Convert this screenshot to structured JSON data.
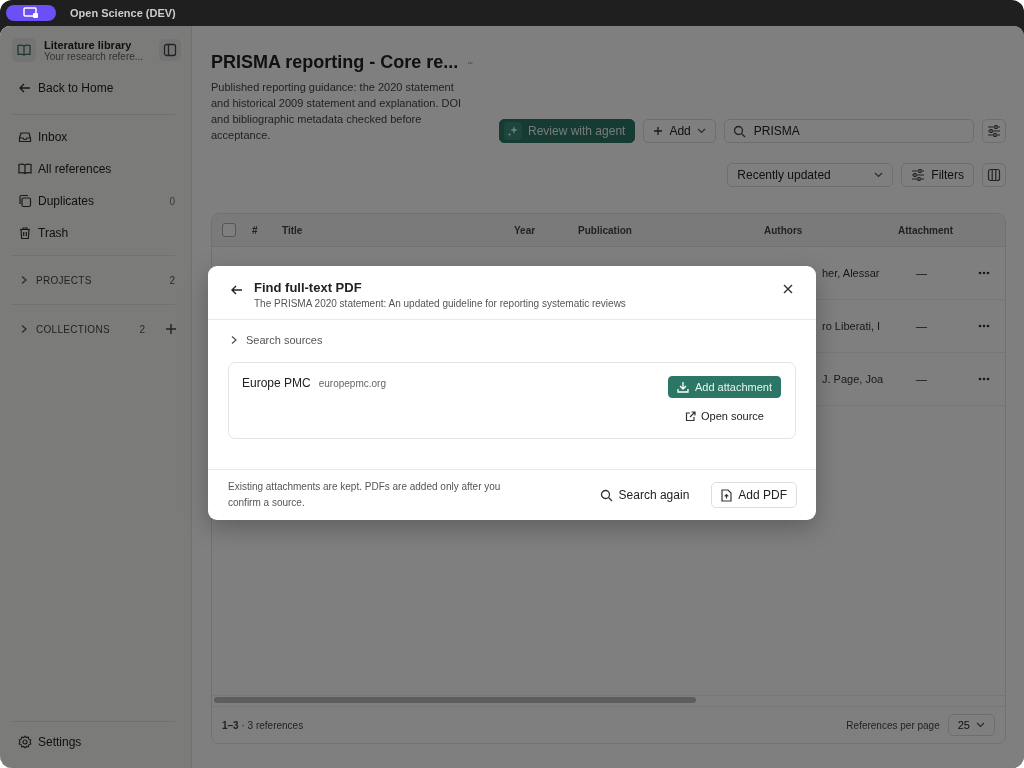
{
  "app_bar": {
    "title": "Open Science (DEV)"
  },
  "sidebar": {
    "library": {
      "title": "Literature library",
      "subtitle": "Your research refere..."
    },
    "back": "Back to Home",
    "items": [
      {
        "kind": "inbox",
        "label": "Inbox"
      },
      {
        "kind": "references",
        "label": "All references"
      },
      {
        "kind": "duplicates",
        "label": "Duplicates",
        "count": "0"
      },
      {
        "kind": "trash",
        "label": "Trash"
      }
    ],
    "sections": [
      {
        "label": "PROJECTS",
        "count": "2",
        "expanded": false,
        "addable": false
      },
      {
        "label": "COLLECTIONS",
        "count": "2",
        "expanded": false,
        "addable": true
      }
    ],
    "settings": "Settings"
  },
  "header": {
    "title": "PRISMA reporting - Core re...",
    "description": "Published reporting guidance: the 2020 statement and historical 2009 statement and explanation. DOI and bibliographic metadata checked before acceptance."
  },
  "toolbar": {
    "review_button": "Review with agent",
    "add_button": "Add",
    "search": {
      "value": "PRISMA"
    },
    "sort": "Recently updated",
    "filters_button": "Filters"
  },
  "table": {
    "select_all": {
      "checked": false
    },
    "columns": [
      "Title",
      "Year",
      "Publication",
      "Authors",
      "Attachment"
    ],
    "number_column": "#",
    "rows": [
      {
        "authors": "her, Alessar",
        "attachment": "—"
      },
      {
        "authors": "ro Liberati, I",
        "attachment": "—"
      },
      {
        "authors": "J. Page, Joa",
        "attachment": "—"
      }
    ],
    "footer": {
      "summary": "**1–3** · 3 references",
      "per_page_label": "References per page",
      "per_page": "25"
    }
  },
  "dialog": {
    "title": "Find full-text PDF",
    "subtitle": "The PRISMA 2020 statement: An updated guideline for reporting systematic reviews",
    "search_sources": {
      "label": "Search sources",
      "expanded": false
    },
    "sources": [
      {
        "name": "Europe PMC",
        "domain": "europepmc.org",
        "add_button": "Add attachment",
        "open_link": "Open source"
      }
    ],
    "note": "Existing attachments are kept. PDFs are added only after you confirm a source.",
    "search_again_button": "Search again",
    "add_pdf_button": "Add PDF"
  }
}
